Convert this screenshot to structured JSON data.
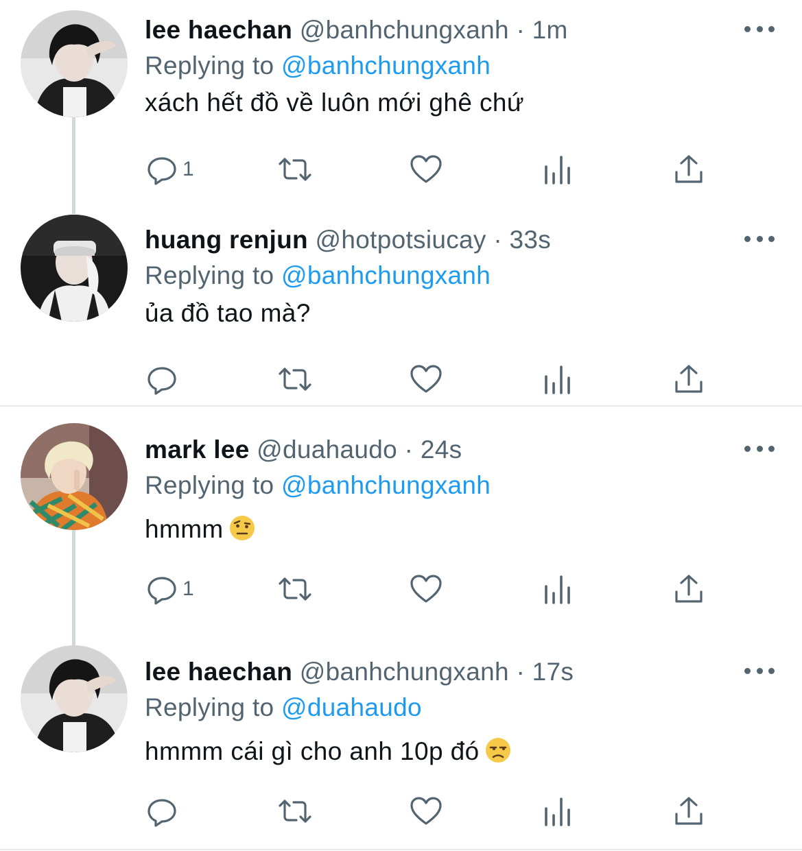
{
  "tweets": [
    {
      "display_name": "lee haechan",
      "handle": "@banhchungxanh",
      "dot": "·",
      "timestamp": "1m",
      "replying_label": "Replying to",
      "reply_to": "@banhchungxanh",
      "text": "xách hết đồ về luôn mới ghê chứ",
      "emoji": "",
      "reply_count": "1"
    },
    {
      "display_name": "huang renjun",
      "handle": "@hotpotsiucay",
      "dot": "·",
      "timestamp": "33s",
      "replying_label": "Replying to",
      "reply_to": "@banhchungxanh",
      "text": "ủa đồ tao mà?",
      "emoji": "",
      "reply_count": ""
    },
    {
      "display_name": "mark lee",
      "handle": "@duahaudo",
      "dot": "·",
      "timestamp": "24s",
      "replying_label": "Replying to",
      "reply_to": "@banhchungxanh",
      "text": "hmmm",
      "emoji": "face-with-raised-eyebrow",
      "reply_count": "1"
    },
    {
      "display_name": "lee haechan",
      "handle": "@banhchungxanh",
      "dot": "·",
      "timestamp": "17s",
      "replying_label": "Replying to",
      "reply_to": "@duahaudo",
      "text": "hmmm cái gì cho anh 10p đó",
      "emoji": "unamused-face",
      "reply_count": ""
    }
  ],
  "colors": {
    "text": "#0f1419",
    "secondary": "#536471",
    "link": "#1d9bf0",
    "thread_line": "#cfd9de",
    "divider": "#e7e9ea"
  },
  "icons": [
    "reply-icon",
    "retweet-icon",
    "like-icon",
    "analytics-icon",
    "share-icon",
    "more-icon"
  ]
}
